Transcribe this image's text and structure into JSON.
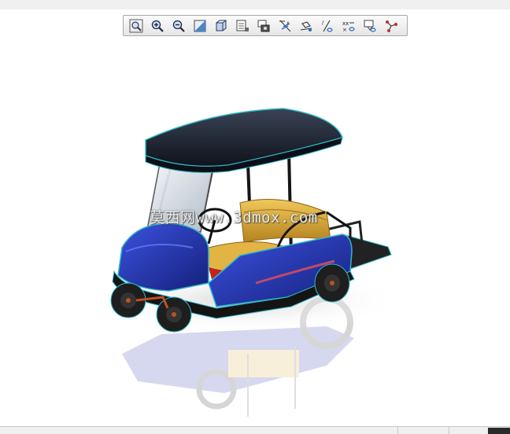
{
  "window": {
    "title": ""
  },
  "toolbar": {
    "buttons": [
      {
        "id": "zoom-fit",
        "icon": "zoom-fit-icon"
      },
      {
        "id": "zoom-in",
        "icon": "zoom-in-icon"
      },
      {
        "id": "zoom-out",
        "icon": "zoom-out-icon"
      },
      {
        "id": "view-orient",
        "icon": "view-orientation-icon"
      },
      {
        "id": "display-style",
        "icon": "display-style-icon"
      },
      {
        "id": "view-manager",
        "icon": "view-manager-icon"
      },
      {
        "id": "named-views",
        "icon": "named-views-icon"
      },
      {
        "id": "datum-planes",
        "icon": "datum-planes-icon"
      },
      {
        "id": "datum-axes",
        "icon": "datum-axes-icon"
      },
      {
        "id": "datum-points",
        "icon": "datum-points-icon"
      },
      {
        "id": "coordinate-systems",
        "icon": "coordinate-systems-icon"
      },
      {
        "id": "annotation-display",
        "icon": "annotation-display-icon"
      },
      {
        "id": "spin-center",
        "icon": "spin-center-icon"
      }
    ]
  },
  "viewport": {
    "model_name": "golf-cart-3d-model",
    "watermark": "莫西网www.3dmox.com"
  },
  "colors": {
    "body_blue": "#1d2fa8",
    "canopy": "#1b2230",
    "seat_yellow": "#d9a838",
    "seat_red": "#c62020",
    "wheel": "#1e1e1e",
    "edge_highlight": "#2fb8c8"
  }
}
